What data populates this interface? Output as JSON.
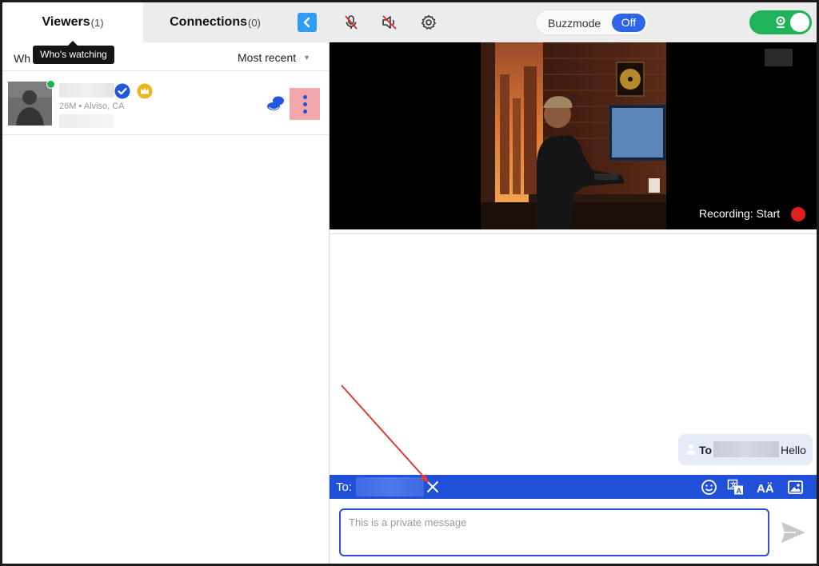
{
  "tabs": {
    "viewers": {
      "label": "Viewers",
      "count": "(1)"
    },
    "connections": {
      "label": "Connections",
      "count": "(0)"
    }
  },
  "toolbar": {
    "back_icon": "chevron-left-icon",
    "mic_icon": "mic-muted-icon",
    "speaker_icon": "speaker-muted-icon",
    "settings_icon": "gear-icon",
    "buzzmode_label": "Buzzmode",
    "buzzmode_state": "Off",
    "camera_toggle_state": "on"
  },
  "tooltip": "Who's watching",
  "viewers_panel": {
    "filter_label": "Wh",
    "sort_label": "Most recent",
    "viewers": [
      {
        "meta": "26M • Alviso, CA",
        "online": true,
        "verified": true,
        "premium": true
      }
    ]
  },
  "video": {
    "recording_label": "Recording: Start"
  },
  "chat": {
    "messages": [
      {
        "to_label": "To",
        "text": "Hello"
      }
    ],
    "to_bar_label": "To:",
    "input_placeholder": "This is a private message"
  },
  "colors": {
    "accent": "#2050d8",
    "online": "#1cb352",
    "record": "#e01f1f",
    "camera_on": "#1fb35a"
  }
}
